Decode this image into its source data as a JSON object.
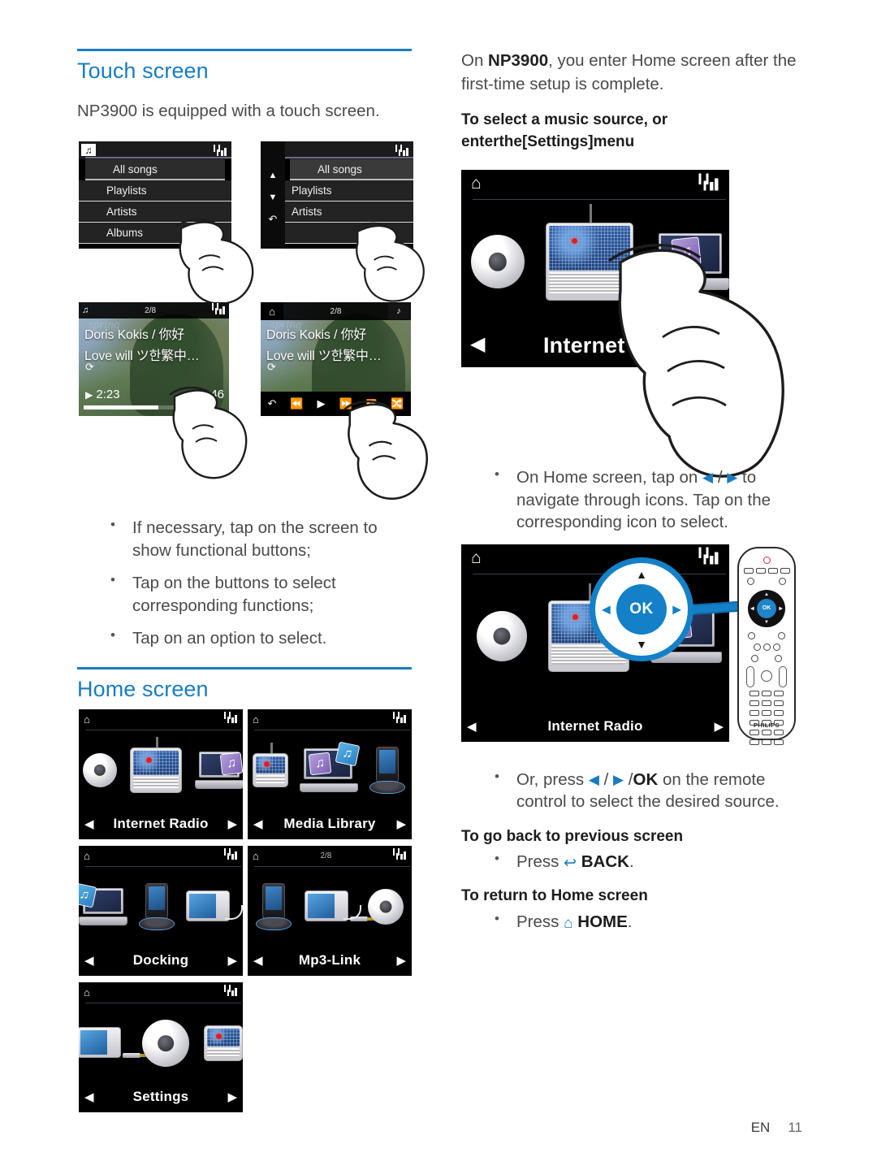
{
  "page": {
    "footer_lang": "EN",
    "footer_number": "11",
    "accent_color": "#1a7cc0"
  },
  "left": {
    "section1_title": "Touch screen",
    "intro": "NP3900 is equipped with a touch screen.",
    "screens_list": {
      "screen_a": {
        "status_icon": "music-note-icon",
        "signal_icon": "signal-bars-icon",
        "rows": [
          "All songs",
          "Playlists",
          "Artists",
          "Albums"
        ]
      },
      "screen_b": {
        "status_icon": "home-icon",
        "signal_icon": "signal-bars-icon",
        "rail_icons": [
          "up-arrow-icon",
          "down-arrow-icon",
          "back-icon"
        ],
        "rows": [
          "All songs",
          "Playlists",
          "Artists"
        ]
      }
    },
    "screens_player": {
      "screen_c": {
        "status_icon": "music-note-icon",
        "track_counter": "2/8",
        "signal_icon": "signal-bars-icon",
        "artist_line": "Doris Kokis / 你好",
        "title_line": "Love will ツ한繁中…",
        "ghost_line": "spring",
        "ghost_sub": "Doris Kokis",
        "repeat_icon": "repeat-icon",
        "play_icon": "play-icon",
        "elapsed": "2:23",
        "total": "46"
      },
      "screen_d": {
        "status_icon": "home-icon",
        "track_counter": "2/8",
        "corner_icon": "now-playing-icon",
        "artist_line": "Doris Kokis / 你好",
        "title_line": "Love will ツ한繁中…",
        "ghost_line": "spring",
        "ghost_sub": "Doris Kokis",
        "repeat_icon": "repeat-icon",
        "controls": [
          "back-icon",
          "rewind-icon",
          "play-icon",
          "forward-icon",
          "repeat-one-icon",
          "shuffle-icon"
        ]
      }
    },
    "bullets": [
      "If necessary, tap on the screen to show functional buttons;",
      "Tap on the buttons to select corresponding functions;",
      "Tap on an option to select."
    ],
    "section2_title": "Home screen",
    "home_tiles": [
      {
        "label": "Internet Radio",
        "status_icon": "home-icon",
        "signal_icon": "signal-bars-icon",
        "counter": ""
      },
      {
        "label": "Media Library",
        "status_icon": "home-icon",
        "signal_icon": "signal-bars-icon",
        "counter": ""
      },
      {
        "label": "Docking",
        "status_icon": "home-icon",
        "signal_icon": "signal-bars-icon",
        "counter": ""
      },
      {
        "label": "Mp3-Link",
        "status_icon": "home-icon",
        "signal_icon": "signal-bars-icon",
        "counter": "2/8"
      },
      {
        "label": "Settings",
        "status_icon": "home-icon",
        "signal_icon": "signal-bars-icon",
        "counter": ""
      }
    ]
  },
  "right": {
    "intro_part1": "On ",
    "intro_device": "NP3900",
    "intro_part2": ", you enter Home screen after the first-time setup is complete.",
    "subhead1_line1": "To select a music source, or",
    "subhead1_line2": "enterthe[Settings]menu",
    "hero1": {
      "label": "Internet R",
      "status_icon": "home-icon",
      "signal_icon": "signal-bars-icon",
      "nav_left_icon": "left-arrow-icon"
    },
    "bullet_nav": {
      "text_before": "On Home screen, tap on ",
      "arrow_left": "◀",
      "slash": " / ",
      "arrow_right": "▶",
      "text_after": " to navigate through icons. Tap on the corresponding icon to select."
    },
    "hero2": {
      "label": "Internet Radio",
      "status_icon": "home-icon",
      "signal_icon": "signal-bars-icon",
      "nav_left_icon": "left-arrow-icon",
      "nav_right_icon": "right-arrow-icon",
      "ok_label": "OK",
      "remote_brand": "PHILIPS"
    },
    "bullet_remote": {
      "text_before": "Or, press ",
      "arrow_left": "◀",
      "slash": " / ",
      "arrow_right": "▶",
      "slash2": " /",
      "ok": "OK",
      "text_after": " on the remote control to select the desired source."
    },
    "subhead2": "To go back to previous screen",
    "bullet_back_pre": "Press ",
    "bullet_back_icon": "back-arrow-icon",
    "bullet_back_key": "BACK",
    "bullet_back_post": ".",
    "subhead3": "To return to Home screen",
    "bullet_home_pre": "Press ",
    "bullet_home_icon": "home-icon",
    "bullet_home_key": "HOME",
    "bullet_home_post": "."
  }
}
